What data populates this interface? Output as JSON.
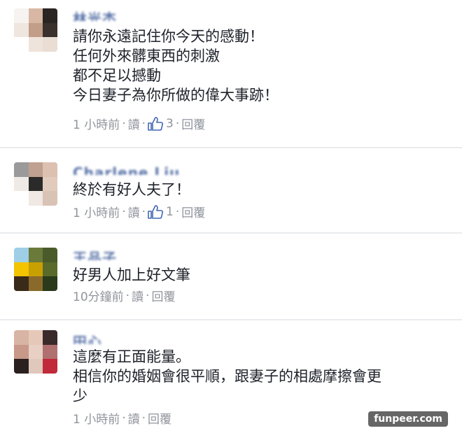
{
  "comments": [
    {
      "author": "林光杰",
      "lines": [
        "請你永遠記住你今天的感動！",
        "任何外來髒東西的刺激",
        "都不足以撼動",
        "今日妻子為你所做的偉大事跡！"
      ],
      "time": "1 小時前",
      "read_label": "讀",
      "like_count": "3",
      "reply_label": "回覆"
    },
    {
      "author": "Charlene Liu",
      "lines": [
        "終於有好人夫了！"
      ],
      "time": "1 小時前",
      "read_label": "讀",
      "like_count": "1",
      "reply_label": "回覆"
    },
    {
      "author": "王品子",
      "lines": [
        "好男人加上好文筆"
      ],
      "time": "10分鐘前",
      "read_label": "讀",
      "reply_label": "回覆"
    },
    {
      "author": "田心",
      "lines": [
        "這麼有正面能量。",
        "相信你的婚姻會很平順，跟妻子的相處摩擦會更",
        "少"
      ],
      "time": "1 小時前",
      "read_label": "讀",
      "reply_label": "回覆"
    }
  ],
  "separator": "·",
  "colors": {
    "meta": "#90949c",
    "author": "#3b5998",
    "like_icon": "#4267b2"
  },
  "icons": {
    "like": "thumbs-up-icon"
  },
  "watermark": "funpeer.com"
}
